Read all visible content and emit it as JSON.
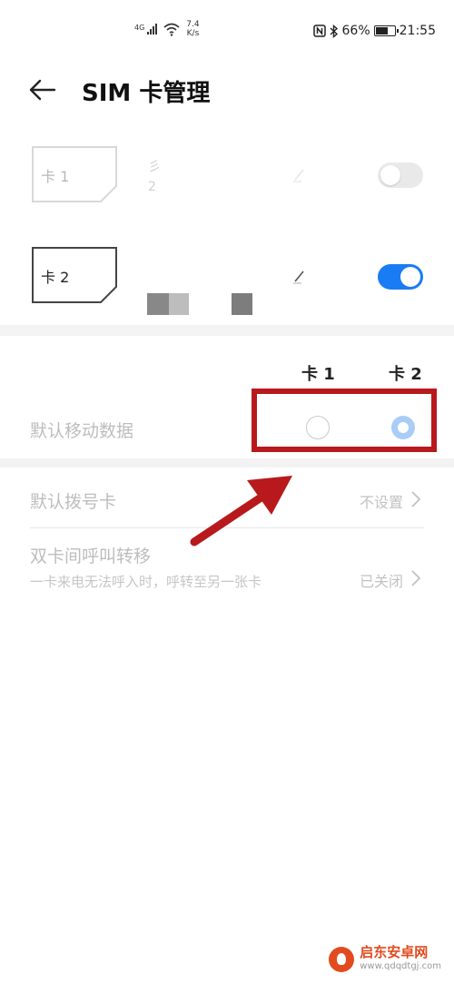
{
  "status_bar": {
    "signal_label": "4G",
    "net_speed_value": "7.4",
    "net_speed_unit": "K/s",
    "nfc_icon": "nfc-icon",
    "bluetooth_icon": "bluetooth-icon",
    "battery_percent": "66%",
    "battery_level": 0.66,
    "time": "21:55"
  },
  "header": {
    "back_icon": "back-arrow-icon",
    "title": "SIM 卡管理"
  },
  "sims": [
    {
      "label": "卡 1",
      "enabled": false,
      "info_line1": "彡",
      "info_line2": "2"
    },
    {
      "label": "卡 2",
      "enabled": true
    }
  ],
  "default_data": {
    "col_card1": "卡 1",
    "col_card2": "卡 2",
    "label": "默认移动数据",
    "selected": "卡 2"
  },
  "settings": [
    {
      "label": "默认拨号卡",
      "value": "不设置"
    },
    {
      "label": "双卡间呼叫转移",
      "sublabel": "一卡来电无法呼入时，呼转至另一张卡",
      "value": "已关闭"
    }
  ],
  "watermark": {
    "name": "启东安卓网",
    "url": "www.qdqdtgj.com"
  },
  "colors": {
    "accent_blue": "#1a7cf4",
    "highlight_red": "#b8191c",
    "watermark_orange": "#e24b20"
  }
}
